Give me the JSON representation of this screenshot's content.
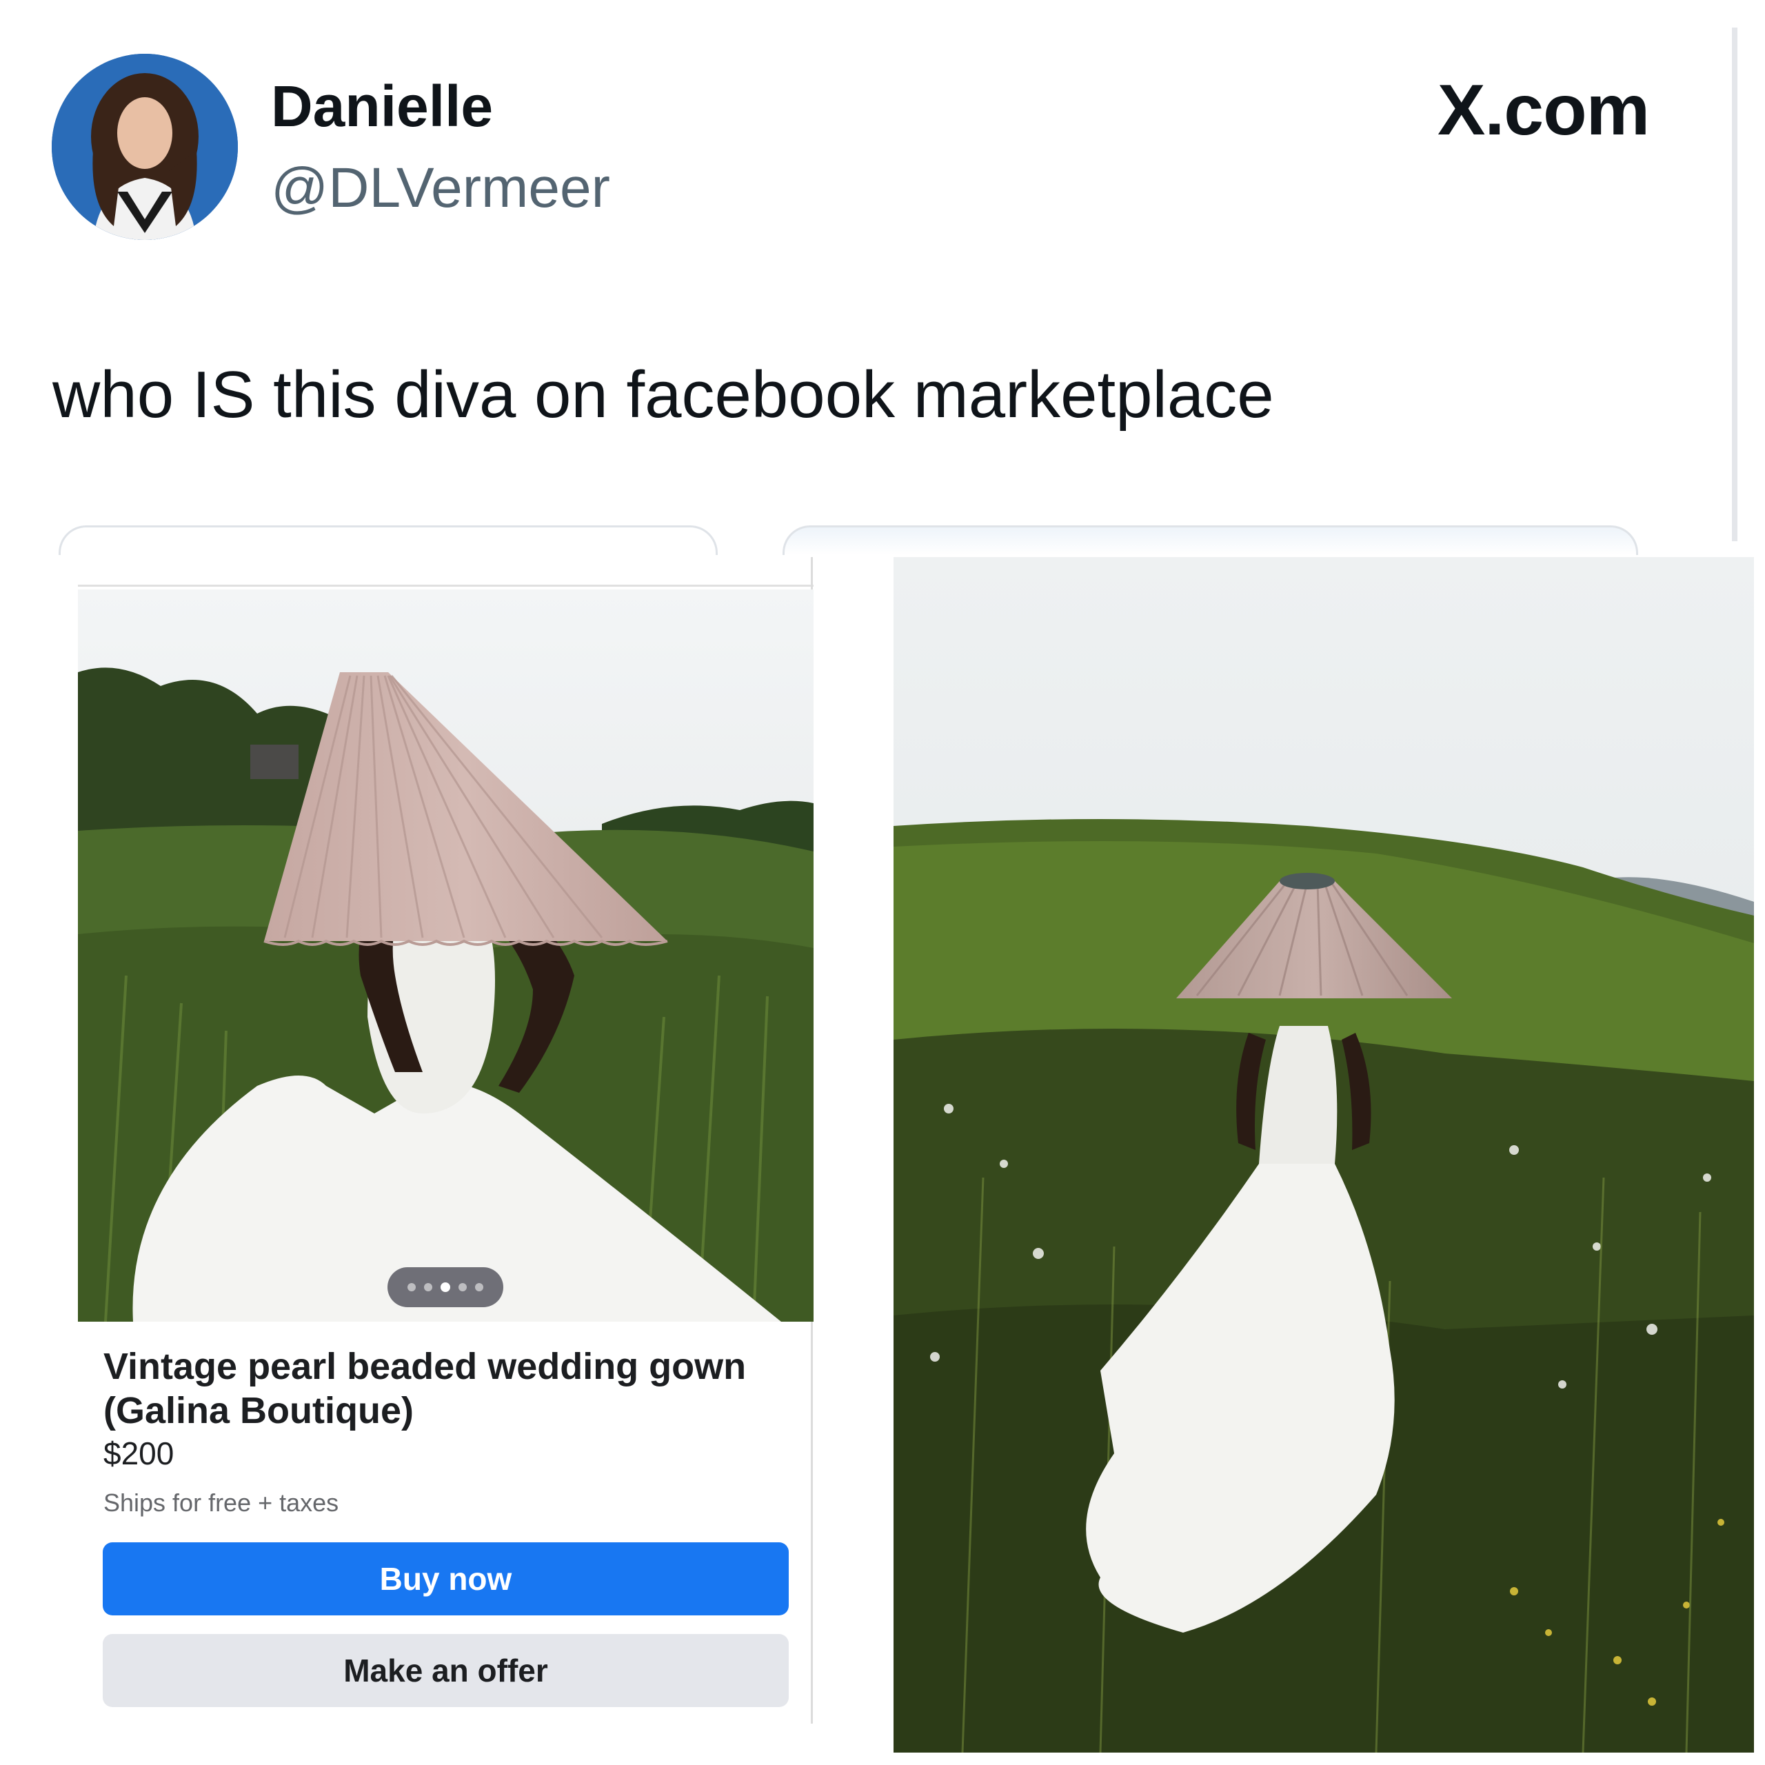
{
  "tweet": {
    "display_name": "Danielle",
    "handle": "@DLVermeer",
    "site_label": "X.com",
    "text": "who IS this diva on facebook marketplace"
  },
  "listing": {
    "title": "Vintage pearl beaded wedding gown (Galina Boutique)",
    "price": "$200",
    "shipping": "Ships for free + taxes",
    "buy_label": "Buy now",
    "offer_label": "Make an offer",
    "photo_count": 5,
    "active_photo_index": 3
  },
  "colors": {
    "buy_button": "#1877f2",
    "offer_button": "#e4e6eb",
    "handle_text": "#536471",
    "lampshade": "#cdb1aa",
    "gown": "#f4f4f2",
    "foliage": "#3f5a23"
  },
  "icons": {
    "site_logo": "x-logo",
    "photo_pager": "pager-dots"
  }
}
